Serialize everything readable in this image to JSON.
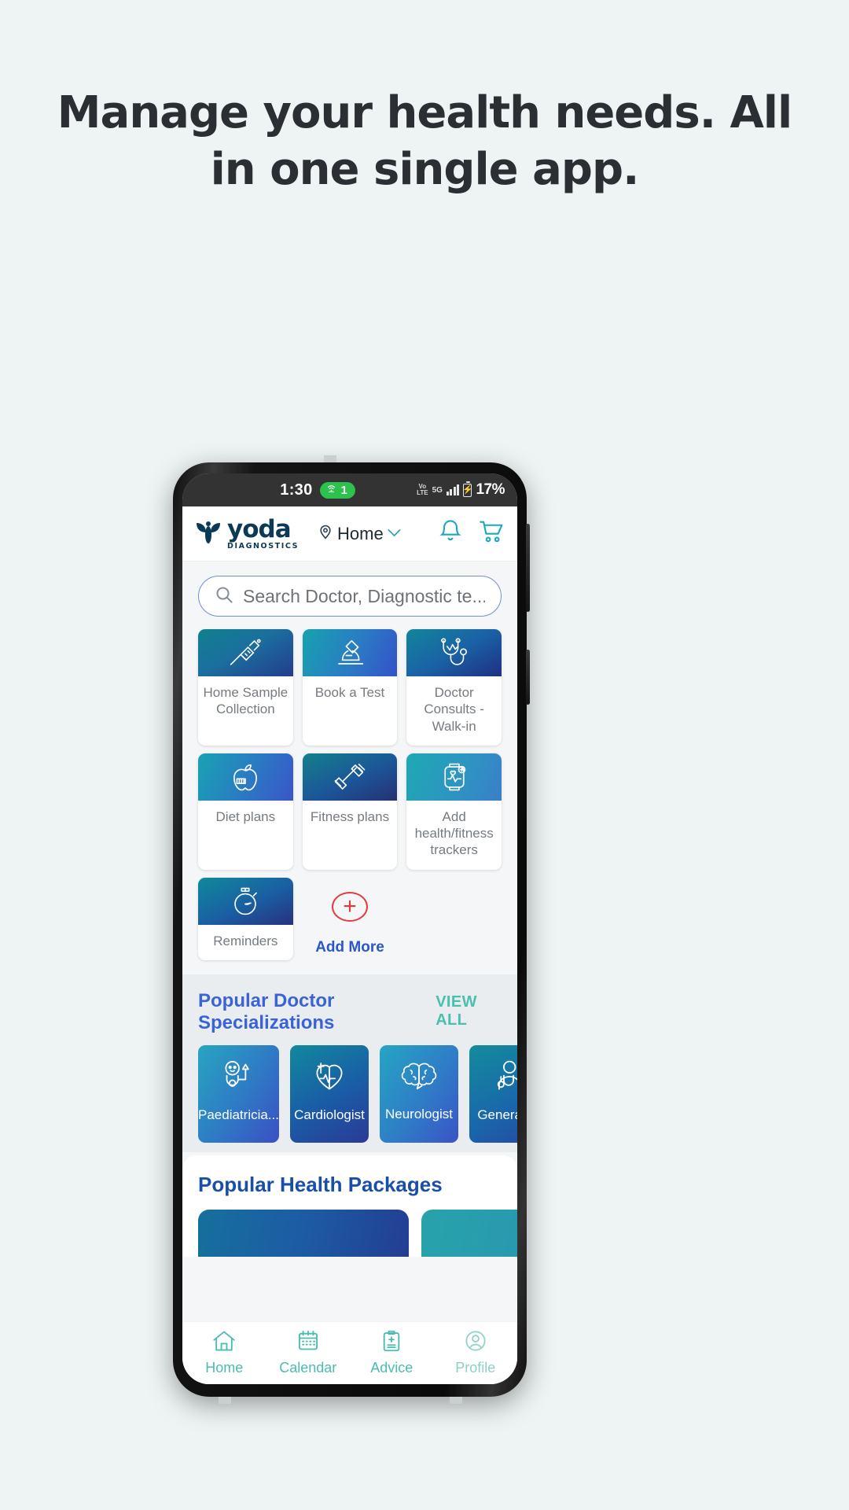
{
  "headline": "Manage your health needs. All in one single app.",
  "status_bar": {
    "time": "1:30",
    "hotspot_count": "1",
    "volte": "VoLTE",
    "network": "5G",
    "battery_percent": "17%"
  },
  "app_header": {
    "logo_word": "yoda",
    "logo_sub": "DIAGNOSTICS",
    "location_label": "Home"
  },
  "search": {
    "placeholder": "Search Doctor, Diagnostic te..."
  },
  "services": {
    "tiles": [
      {
        "label": "Home Sample Collection",
        "icon": "syringe-icon"
      },
      {
        "label": "Book a Test",
        "icon": "microscope-icon"
      },
      {
        "label": "Doctor Consults - Walk-in",
        "icon": "stethoscope-icon"
      },
      {
        "label": "Diet plans",
        "icon": "apple-icon"
      },
      {
        "label": "Fitness plans",
        "icon": "dumbbell-icon"
      },
      {
        "label": "Add health/fitness trackers",
        "icon": "smartwatch-icon"
      },
      {
        "label": "Reminders",
        "icon": "stopwatch-icon"
      }
    ],
    "add_more_label": "Add More",
    "add_more_icon": "plus-circle-icon"
  },
  "specializations": {
    "title": "Popular Doctor Specializations",
    "view_all": "VIEW ALL",
    "cards": [
      {
        "label": "Paediatricia...",
        "icon": "baby-stethoscope-icon"
      },
      {
        "label": "Cardiologist",
        "icon": "heart-icon"
      },
      {
        "label": "Neurologist",
        "icon": "brain-icon"
      },
      {
        "label": "General M",
        "icon": "doctor-icon"
      }
    ]
  },
  "packages": {
    "title": "Popular Health Packages"
  },
  "bottom_nav": {
    "items": [
      {
        "label": "Home",
        "icon": "home-icon"
      },
      {
        "label": "Calendar",
        "icon": "calendar-icon"
      },
      {
        "label": "Advice",
        "icon": "clipboard-icon"
      },
      {
        "label": "Profile",
        "icon": "user-icon"
      }
    ]
  },
  "colors": {
    "page_bg": "#eef4f4",
    "brand_navy": "#0b3a57",
    "teal": "#4bbdae",
    "blue_title": "#3a63d8",
    "red_accent": "#e23b3b"
  }
}
